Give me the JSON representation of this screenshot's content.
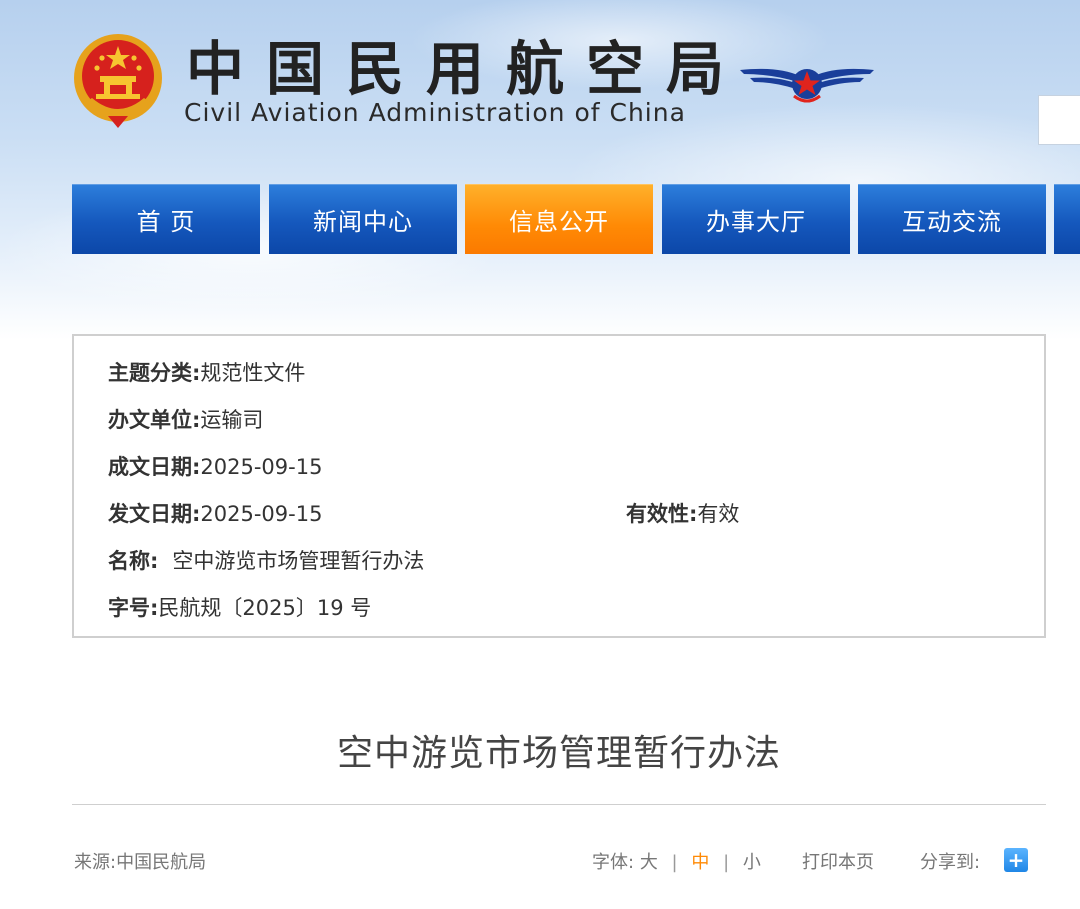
{
  "header": {
    "title_cn": "中国民用航空局",
    "title_en": "Civil Aviation Administration of China",
    "emblem_icon": "national-emblem-icon",
    "logo_icon": "caac-wings-star-icon"
  },
  "nav": {
    "items": [
      {
        "label": "首 页"
      },
      {
        "label": "新闻中心"
      },
      {
        "label": "信息公开"
      },
      {
        "label": "办事大厅"
      },
      {
        "label": "互动交流"
      }
    ],
    "active_label": "信息公开",
    "colors": {
      "item": "#1558bd",
      "active": "#ff8a05"
    }
  },
  "info": {
    "topic": {
      "label": "主题分类:",
      "value": "规范性文件"
    },
    "dept": {
      "label": "办文单位:",
      "value": "运输司"
    },
    "created": {
      "label": "成文日期:",
      "value": "2025-09-15"
    },
    "issued": {
      "label": "发文日期:",
      "value": "2025-09-15"
    },
    "validity": {
      "label": "有效性:",
      "value": "有效"
    },
    "name": {
      "label": "名称:",
      "value": "空中游览市场管理暂行办法"
    },
    "docno": {
      "label": "字号:",
      "value": "民航规〔2025〕19 号"
    }
  },
  "article": {
    "title": "空中游览市场管理暂行办法"
  },
  "footer_bar": {
    "source_label": "来源:",
    "source_value": "中国民航局",
    "font_label": "字体:",
    "font_large": "大",
    "font_medium": "中",
    "font_small": "小",
    "separator": "|",
    "print_label": "打印本页",
    "share_label": "分享到:",
    "share_icon": "plus-share-icon",
    "share_symbol": "+"
  }
}
